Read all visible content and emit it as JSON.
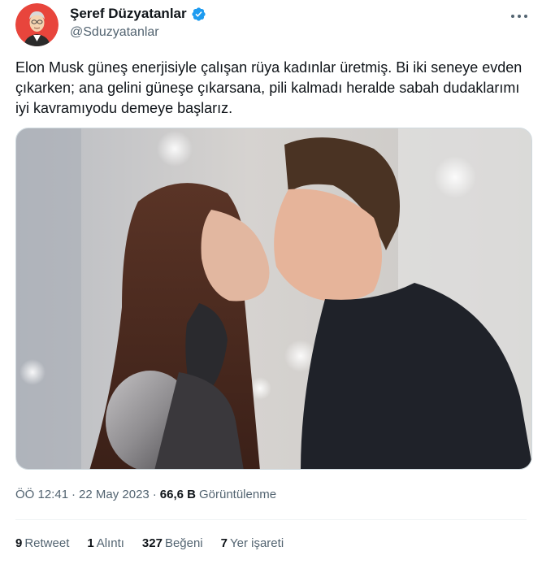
{
  "author": {
    "display_name": "Şeref Düzyatanlar",
    "handle": "@Sduzyatanlar",
    "verified": true
  },
  "tweet": {
    "text": "Elon Musk güneş enerjisiyle çalışan rüya kadınlar üretmiş. Bi iki seneye evden çıkarken; ana gelini güneşe çıkarsana, pili kalmadı heralde sabah dudaklarımı iyi kavramıyodu demeye başlarız."
  },
  "meta": {
    "time": "ÖÖ 12:41",
    "separator": "·",
    "date": "22 May 2023",
    "separator2": "·",
    "views_count": "66,6 B",
    "views_label": "Görüntülenme"
  },
  "stats": {
    "retweets_count": "9",
    "retweets_label": "Retweet",
    "quotes_count": "1",
    "quotes_label": "Alıntı",
    "likes_count": "327",
    "likes_label": "Beğeni",
    "bookmarks_count": "7",
    "bookmarks_label": "Yer işareti"
  },
  "icons": {
    "verified": "verified-badge-icon",
    "more": "more-options-icon"
  },
  "colors": {
    "verified_blue": "#1d9bf0",
    "secondary_text": "#536471",
    "primary_text": "#0f1419"
  }
}
